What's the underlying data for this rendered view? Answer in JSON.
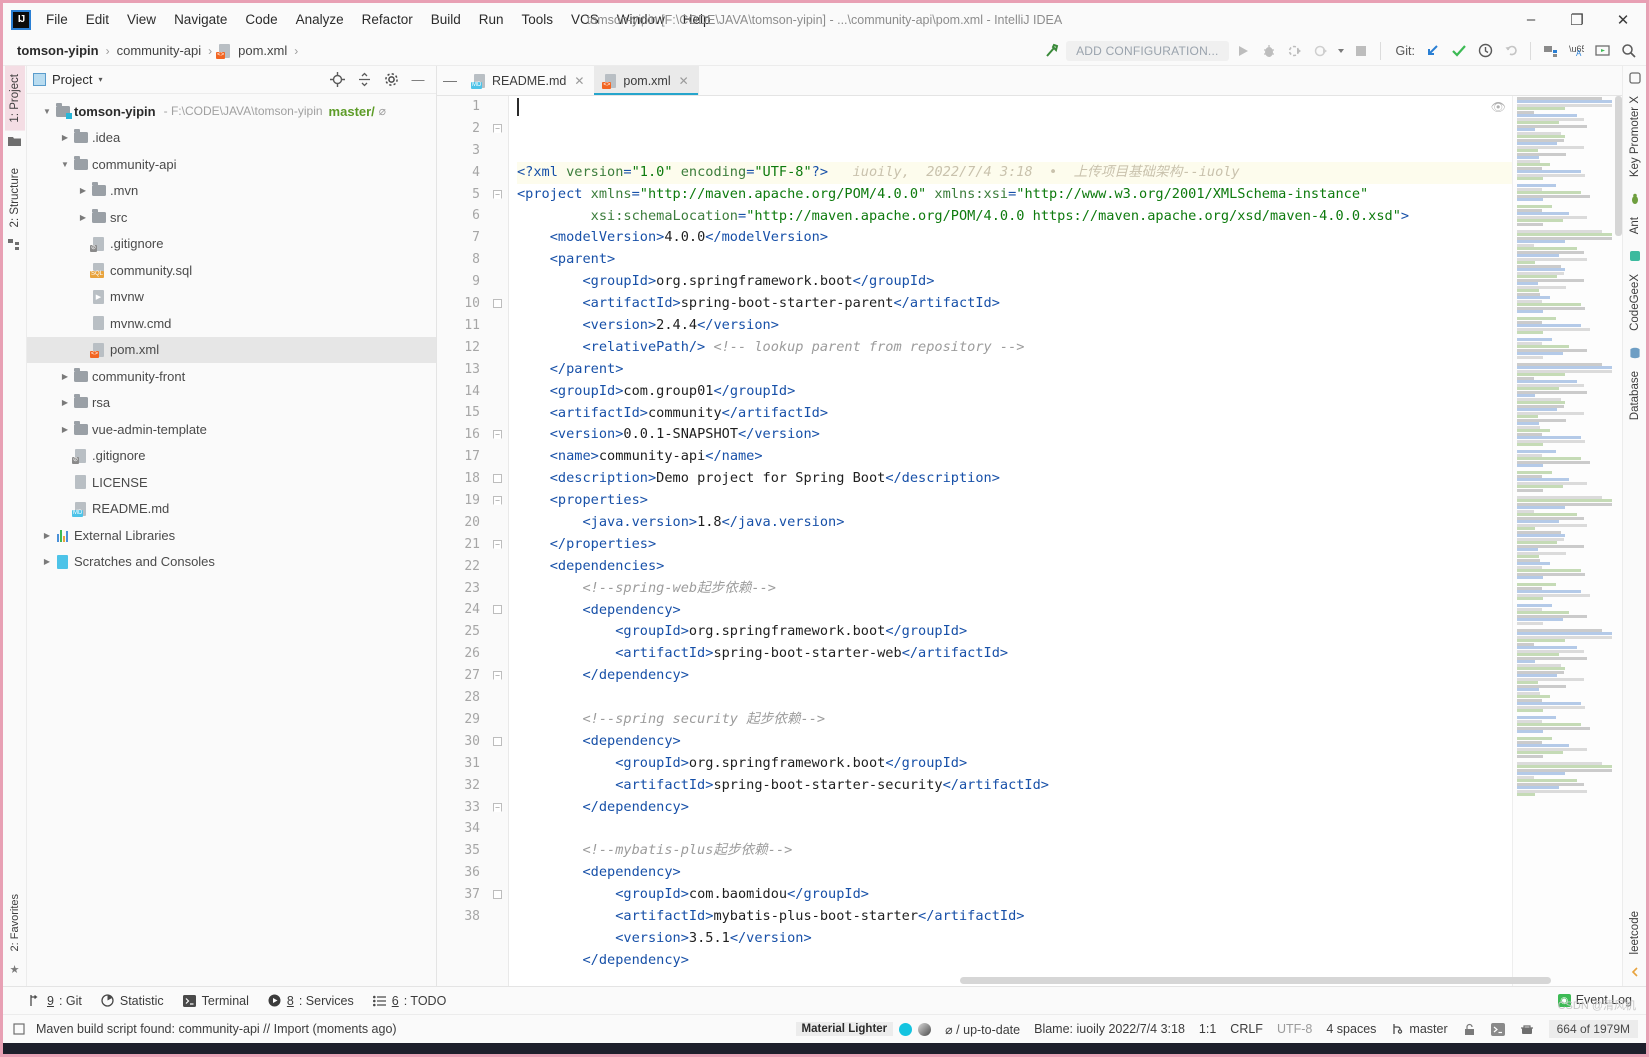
{
  "window": {
    "title": "tomson-yipin [F:\\CODE\\JAVA\\tomson-yipin] - ...\\community-api\\pom.xml - IntelliJ IDEA",
    "logo_text": "IJ",
    "minimize": "–",
    "maximize": "❐",
    "close": "✕"
  },
  "menu": {
    "items": [
      "File",
      "Edit",
      "View",
      "Navigate",
      "Code",
      "Analyze",
      "Refactor",
      "Build",
      "Run",
      "Tools",
      "VCS",
      "Window",
      "Help"
    ]
  },
  "breadcrumb": {
    "items": [
      "tomson-yipin",
      "community-api",
      "pom.xml"
    ],
    "separator": "›"
  },
  "toolbar": {
    "add_configuration": "ADD CONFIGURATION...",
    "git_label": "Git:",
    "icons": [
      "build-hammer-icon",
      "run-icon",
      "debug-icon",
      "run-with-coverage-icon",
      "profile-icon",
      "stop-icon",
      "update-project-icon",
      "commit-icon",
      "history-icon",
      "rollback-icon",
      "project-structure-icon",
      "translate-icon",
      "present-icon",
      "search-everywhere-icon"
    ]
  },
  "left_strip": {
    "tabs": [
      "1: Project",
      "2: Structure"
    ]
  },
  "right_strip": {
    "tabs": [
      "Key Promoter X",
      "Ant",
      "CodeGeeX",
      "Database",
      "leetcode"
    ]
  },
  "project_panel": {
    "title": "Project",
    "caret": "▾",
    "actions": [
      "locate-icon",
      "collapse-all-icon",
      "settings-gear-icon",
      "hide-icon"
    ],
    "tree": [
      {
        "indent": 0,
        "arrow": "▼",
        "icon": "folder-module-icon",
        "name": "tomson-yipin",
        "bold": true,
        "sub": "- F:\\CODE\\JAVA\\tomson-yipin",
        "branch": "master/",
        "branch_suffix": "⌀"
      },
      {
        "indent": 1,
        "arrow": "▶",
        "icon": "folder-icon",
        "name": ".idea"
      },
      {
        "indent": 1,
        "arrow": "▼",
        "icon": "folder-icon",
        "name": "community-api"
      },
      {
        "indent": 2,
        "arrow": "▶",
        "icon": "folder-icon",
        "name": ".mvn"
      },
      {
        "indent": 2,
        "arrow": "▶",
        "icon": "folder-icon",
        "name": "src"
      },
      {
        "indent": 2,
        "arrow": "",
        "icon": "gitignore-file-icon",
        "name": ".gitignore"
      },
      {
        "indent": 2,
        "arrow": "",
        "icon": "sql-file-icon",
        "name": "community.sql"
      },
      {
        "indent": 2,
        "arrow": "",
        "icon": "shell-file-icon",
        "name": "mvnw"
      },
      {
        "indent": 2,
        "arrow": "",
        "icon": "text-file-icon",
        "name": "mvnw.cmd"
      },
      {
        "indent": 2,
        "arrow": "",
        "icon": "xml-file-icon",
        "name": "pom.xml",
        "selected": true
      },
      {
        "indent": 1,
        "arrow": "▶",
        "icon": "folder-icon",
        "name": "community-front"
      },
      {
        "indent": 1,
        "arrow": "▶",
        "icon": "folder-icon",
        "name": "rsa"
      },
      {
        "indent": 1,
        "arrow": "▶",
        "icon": "folder-icon",
        "name": "vue-admin-template"
      },
      {
        "indent": 1,
        "arrow": "",
        "icon": "gitignore-file-icon",
        "name": ".gitignore"
      },
      {
        "indent": 1,
        "arrow": "",
        "icon": "text-file-icon",
        "name": "LICENSE"
      },
      {
        "indent": 1,
        "arrow": "",
        "icon": "markdown-file-icon",
        "name": "README.md"
      },
      {
        "indent": 0,
        "arrow": "▶",
        "icon": "libraries-icon",
        "name": "External Libraries"
      },
      {
        "indent": 0,
        "arrow": "▶",
        "icon": "scratches-icon",
        "name": "Scratches and Consoles"
      }
    ]
  },
  "editor": {
    "tabs": [
      {
        "label": "README.md",
        "icon": "markdown-file-icon",
        "active": false,
        "close": "✕"
      },
      {
        "label": "pom.xml",
        "icon": "xml-file-icon",
        "active": true,
        "close": "✕"
      }
    ],
    "blame_annotation": "iuoily,  2022/7/4 3:18  •  上传项目基础架构--iuoly",
    "first_line": 1,
    "last_line": 38,
    "lines": [
      {
        "n": 1,
        "fold": "",
        "html": "<span class=\"tg\">&lt;?xml </span><span class=\"at\">version</span><span class=\"tg\">=</span><span class=\"st\">\"1.0\"</span> <span class=\"at\">encoding</span><span class=\"tg\">=</span><span class=\"st\">\"UTF-8\"</span><span class=\"tg\">?&gt;</span>   <span class=\"blame\">iuoily,  2022/7/4 3:18  •  上传项目基础架构--iuoly</span>",
        "hl": true
      },
      {
        "n": 2,
        "fold": "open",
        "html": "<span class=\"tg\">&lt;project </span><span class=\"at\">xmlns</span><span class=\"tg\">=</span><span class=\"st\">\"http://maven.apache.org/POM/4.0.0\"</span> <span class=\"at\">xmlns:xsi</span><span class=\"tg\">=</span><span class=\"st\">\"http://www.w3.org/2001/XMLSchema-instance\"</span>"
      },
      {
        "n": 3,
        "fold": "",
        "html": "         <span class=\"at\">xsi:schemaLocation</span><span class=\"tg\">=</span><span class=\"st\">\"http://maven.apache.org/POM/4.0.0 https://maven.apache.org/xsd/maven-4.0.0.xsd\"</span><span class=\"tg\">&gt;</span>"
      },
      {
        "n": 4,
        "fold": "",
        "html": "    <span class=\"tg\">&lt;modelVersion&gt;</span><span class=\"txt\">4.0.0</span><span class=\"tg\">&lt;/modelVersion&gt;</span>"
      },
      {
        "n": 5,
        "fold": "open",
        "html": "    <span class=\"tg\">&lt;parent&gt;</span>"
      },
      {
        "n": 6,
        "fold": "",
        "html": "        <span class=\"tg\">&lt;groupId&gt;</span><span class=\"txt\">org.springframework.boot</span><span class=\"tg\">&lt;/groupId&gt;</span>"
      },
      {
        "n": 7,
        "fold": "",
        "html": "        <span class=\"tg\">&lt;artifactId&gt;</span><span class=\"txt\">spring-boot-starter-parent</span><span class=\"tg\">&lt;/artifactId&gt;</span>"
      },
      {
        "n": 8,
        "fold": "",
        "html": "        <span class=\"tg\">&lt;version&gt;</span><span class=\"txt\">2.4.4</span><span class=\"tg\">&lt;/version&gt;</span>"
      },
      {
        "n": 9,
        "fold": "",
        "html": "        <span class=\"tg\">&lt;relativePath/&gt;</span> <span class=\"cm\">&lt;!-- lookup parent from repository --&gt;</span>"
      },
      {
        "n": 10,
        "fold": "close",
        "html": "    <span class=\"tg\">&lt;/parent&gt;</span>"
      },
      {
        "n": 11,
        "fold": "",
        "html": "    <span class=\"tg\">&lt;groupId&gt;</span><span class=\"txt\">com.group01</span><span class=\"tg\">&lt;/groupId&gt;</span>"
      },
      {
        "n": 12,
        "fold": "",
        "html": "    <span class=\"tg\">&lt;artifactId&gt;</span><span class=\"txt\">community</span><span class=\"tg\">&lt;/artifactId&gt;</span>"
      },
      {
        "n": 13,
        "fold": "",
        "html": "    <span class=\"tg\">&lt;version&gt;</span><span class=\"txt\">0.0.1-SNAPSHOT</span><span class=\"tg\">&lt;/version&gt;</span>"
      },
      {
        "n": 14,
        "fold": "",
        "html": "    <span class=\"tg\">&lt;name&gt;</span><span class=\"txt\">community-api</span><span class=\"tg\">&lt;/name&gt;</span>"
      },
      {
        "n": 15,
        "fold": "",
        "html": "    <span class=\"tg\">&lt;description&gt;</span><span class=\"txt\">Demo project for Spring Boot</span><span class=\"tg\">&lt;/description&gt;</span>"
      },
      {
        "n": 16,
        "fold": "open",
        "html": "    <span class=\"tg\">&lt;properties&gt;</span>"
      },
      {
        "n": 17,
        "fold": "",
        "html": "        <span class=\"tg\">&lt;java.version&gt;</span><span class=\"txt\">1.8</span><span class=\"tg\">&lt;/java.version&gt;</span>"
      },
      {
        "n": 18,
        "fold": "close",
        "html": "    <span class=\"tg\">&lt;/properties&gt;</span>"
      },
      {
        "n": 19,
        "fold": "open",
        "html": "    <span class=\"tg\">&lt;dependencies&gt;</span>"
      },
      {
        "n": 20,
        "fold": "",
        "html": "        <span class=\"cm\">&lt;!--spring-web起步依赖--&gt;</span>"
      },
      {
        "n": 21,
        "fold": "open",
        "html": "        <span class=\"tg\">&lt;dependency&gt;</span>"
      },
      {
        "n": 22,
        "fold": "",
        "html": "            <span class=\"tg\">&lt;groupId&gt;</span><span class=\"txt\">org.springframework.boot</span><span class=\"tg\">&lt;/groupId&gt;</span>"
      },
      {
        "n": 23,
        "fold": "",
        "html": "            <span class=\"tg\">&lt;artifactId&gt;</span><span class=\"txt\">spring-boot-starter-web</span><span class=\"tg\">&lt;/artifactId&gt;</span>"
      },
      {
        "n": 24,
        "fold": "close",
        "html": "        <span class=\"tg\">&lt;/dependency&gt;</span>"
      },
      {
        "n": 25,
        "fold": "",
        "html": ""
      },
      {
        "n": 26,
        "fold": "",
        "html": "        <span class=\"cm\">&lt;!--spring security 起步依赖--&gt;</span>"
      },
      {
        "n": 27,
        "fold": "open",
        "html": "        <span class=\"tg\">&lt;dependency&gt;</span>"
      },
      {
        "n": 28,
        "fold": "",
        "html": "            <span class=\"tg\">&lt;groupId&gt;</span><span class=\"txt\">org.springframework.boot</span><span class=\"tg\">&lt;/groupId&gt;</span>"
      },
      {
        "n": 29,
        "fold": "",
        "html": "            <span class=\"tg\">&lt;artifactId&gt;</span><span class=\"txt\">spring-boot-starter-security</span><span class=\"tg\">&lt;/artifactId&gt;</span>"
      },
      {
        "n": 30,
        "fold": "close",
        "html": "        <span class=\"tg\">&lt;/dependency&gt;</span>"
      },
      {
        "n": 31,
        "fold": "",
        "html": ""
      },
      {
        "n": 32,
        "fold": "",
        "html": "        <span class=\"cm\">&lt;!--mybatis-plus起步依赖--&gt;</span>"
      },
      {
        "n": 33,
        "fold": "open",
        "html": "        <span class=\"tg\">&lt;dependency&gt;</span>"
      },
      {
        "n": 34,
        "fold": "",
        "html": "            <span class=\"tg\">&lt;groupId&gt;</span><span class=\"txt\">com.baomidou</span><span class=\"tg\">&lt;/groupId&gt;</span>"
      },
      {
        "n": 35,
        "fold": "",
        "html": "            <span class=\"tg\">&lt;artifactId&gt;</span><span class=\"txt\">mybatis-plus-boot-starter</span><span class=\"tg\">&lt;/artifactId&gt;</span>"
      },
      {
        "n": 36,
        "fold": "",
        "html": "            <span class=\"tg\">&lt;version&gt;</span><span class=\"txt\">3.5.1</span><span class=\"tg\">&lt;/version&gt;</span>"
      },
      {
        "n": 37,
        "fold": "close",
        "html": "        <span class=\"tg\">&lt;/dependency&gt;</span>"
      },
      {
        "n": 38,
        "fold": "",
        "html": ""
      }
    ]
  },
  "bottom_tools": [
    {
      "icon": "git-branch-icon",
      "num": "9",
      "label": ": Git"
    },
    {
      "icon": "statistic-icon",
      "num": "",
      "label": "Statistic"
    },
    {
      "icon": "terminal-icon",
      "num": "",
      "label": "Terminal"
    },
    {
      "icon": "services-icon",
      "num": "8",
      "label": ": Services"
    },
    {
      "icon": "todo-icon",
      "num": "6",
      "label": ": TODO"
    }
  ],
  "status": {
    "message": "Maven build script found: community-api // Import (moments ago)",
    "message_icon": "notification-icon",
    "theme_name": "Material Lighter",
    "vcs_state": "⌀ / up-to-date",
    "blame": "Blame: iuoily 2022/7/4 3:18",
    "caret_position": "1:1",
    "line_separator": "CRLF",
    "encoding": "UTF-8",
    "indent": "4 spaces",
    "branch": "master",
    "memory": "664 of 1979M",
    "event_log": "Event Log",
    "icons": [
      "lock-icon",
      "terminal-small-icon",
      "inspector-icon"
    ]
  },
  "watermark": "CSDN @清风机",
  "colors": {
    "accent_pink": "#e8a0b4",
    "tab_underline": "#26a5cc",
    "branch_green": "#5d9c28",
    "xml_tag": "#1750a8",
    "xml_string": "#0d7a0d",
    "comment_gray": "#9c9c9c",
    "blame_text": "#c9c2ad"
  }
}
